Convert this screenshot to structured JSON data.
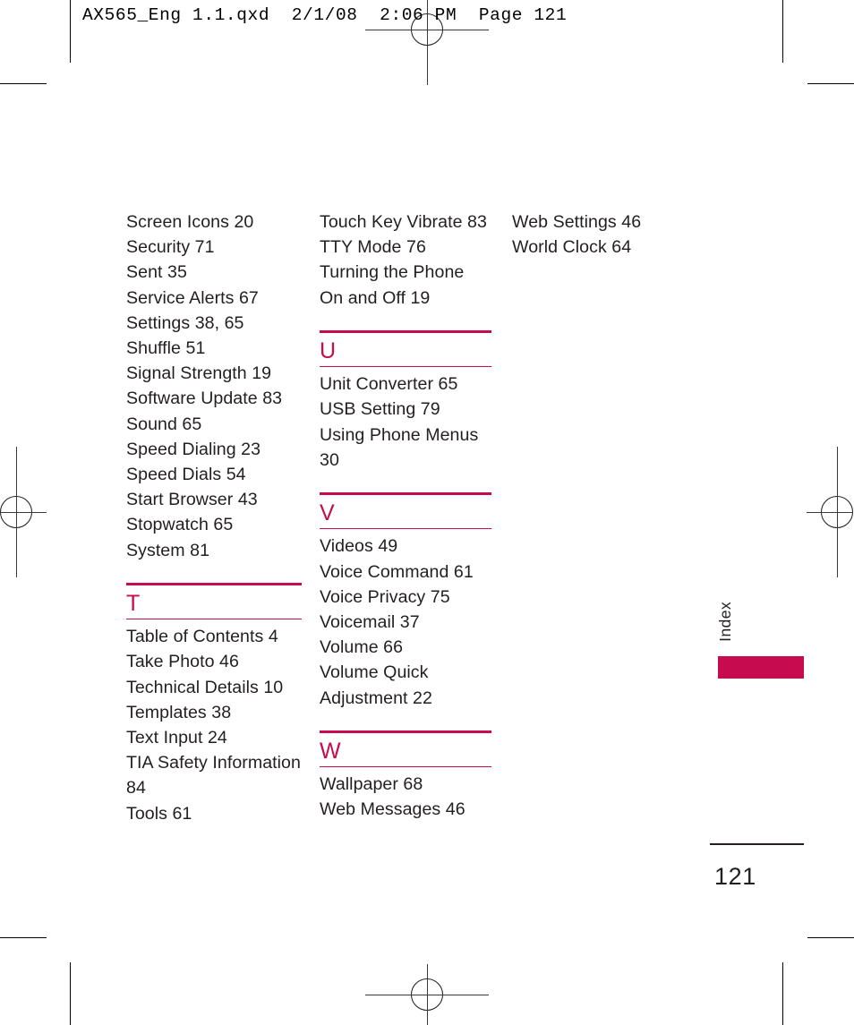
{
  "header": {
    "slug": "AX565_Eng 1.1.qxd  2/1/08  2:06 PM  Page 121"
  },
  "colors": {
    "accent": "#C60B4E",
    "text": "#231F20"
  },
  "index": {
    "columns": [
      {
        "sections": [
          {
            "letter": "",
            "entries": [
              "Screen Icons 20",
              "Security 71",
              "Sent 35",
              "Service Alerts 67",
              "Settings 38, 65",
              "Shuffle 51",
              "Signal Strength 19",
              "Software Update 83",
              "Sound 65",
              "Speed Dialing 23",
              "Speed Dials 54",
              "Start Browser 43",
              "Stopwatch 65",
              "System 81"
            ]
          },
          {
            "letter": "T",
            "entries": [
              "Table of Contents 4",
              "Take Photo 46",
              "Technical Details 10",
              "Templates 38",
              "Text Input 24",
              "TIA Safety Information 84",
              "Tools 61"
            ]
          }
        ]
      },
      {
        "sections": [
          {
            "letter": "",
            "entries": [
              "Touch Key Vibrate 83",
              "TTY Mode 76",
              "Turning the Phone On and Off 19"
            ]
          },
          {
            "letter": "U",
            "entries": [
              "Unit Converter 65",
              "USB Setting 79",
              "Using Phone Menus 30"
            ]
          },
          {
            "letter": "V",
            "entries": [
              "Videos 49",
              "Voice Command 61",
              "Voice Privacy 75",
              "Voicemail 37",
              "Volume 66",
              "Volume Quick Adjustment 22"
            ]
          },
          {
            "letter": "W",
            "entries": [
              "Wallpaper 68",
              "Web Messages 46"
            ]
          }
        ]
      },
      {
        "sections": [
          {
            "letter": "",
            "entries": [
              "Web Settings 46",
              "World Clock 64"
            ]
          }
        ]
      }
    ]
  },
  "sidebar": {
    "tab_label": "Index"
  },
  "footer": {
    "page_number": "121"
  }
}
